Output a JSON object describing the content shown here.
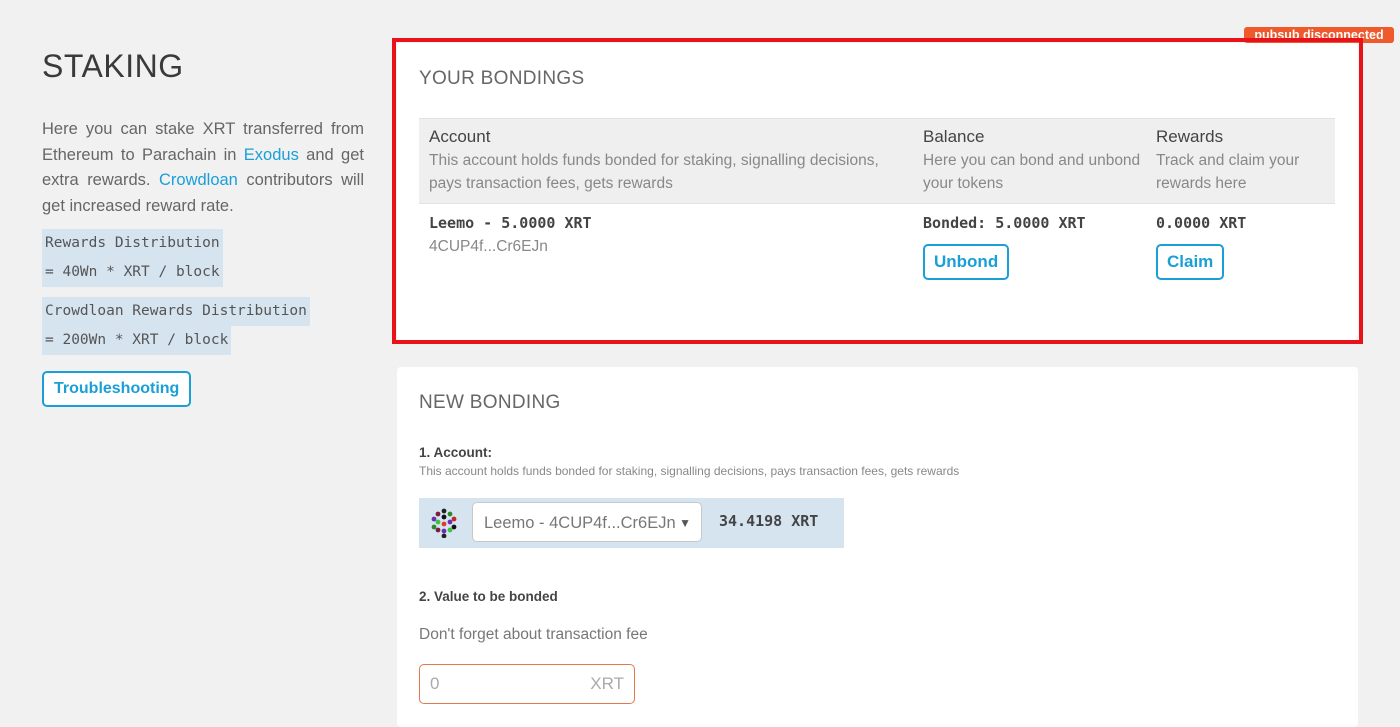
{
  "sidebar": {
    "title": "STAKING",
    "intro_1": "Here you can stake XRT transferred from Ethereum to Parachain in ",
    "exodus_link": "Exodus",
    "intro_2": " and get extra rewards. ",
    "crowdloan_link": "Crowdloan",
    "intro_3": " contributors will get increased reward rate.",
    "rewards_line1": "Rewards Distribution",
    "rewards_line2": "= 40Wn * XRT / block",
    "crowdloan_line1": "Crowdloan Rewards Distribution",
    "crowdloan_line2": "= 200Wn * XRT / block",
    "troubleshooting": "Troubleshooting"
  },
  "pubsub_badge": "pubsub disconnected",
  "bondings": {
    "title": "YOUR BONDINGS",
    "columns": {
      "account": {
        "title": "Account",
        "desc": "This account holds funds bonded for staking, signalling decisions, pays transaction fees, gets rewards"
      },
      "balance": {
        "title": "Balance",
        "desc": "Here you can bond and unbond your tokens"
      },
      "rewards": {
        "title": "Rewards",
        "desc": "Track and claim your rewards here"
      }
    },
    "row": {
      "account_name": "Leemo - 5.0000 XRT",
      "address": "4CUP4f...Cr6EJn",
      "bonded": "Bonded: 5.0000 XRT",
      "unbond": "Unbond",
      "rewards": "0.0000 XRT",
      "claim": "Claim"
    }
  },
  "new_bonding": {
    "title": "NEW BONDING",
    "account_label": "1. Account:",
    "account_desc": "This account holds funds bonded for staking, signalling decisions, pays transaction fees, gets rewards",
    "selected_account": "Leemo - 4CUP4f...Cr6EJn",
    "account_balance": "34.4198 XRT",
    "value_label": "2. Value to be bonded",
    "fee_note": "Don't forget about transaction fee",
    "value": "0",
    "unit": "XRT"
  },
  "colors": {
    "accent": "#1a9fd6",
    "highlight": "#e8121b",
    "badge": "#ee5a2c"
  }
}
